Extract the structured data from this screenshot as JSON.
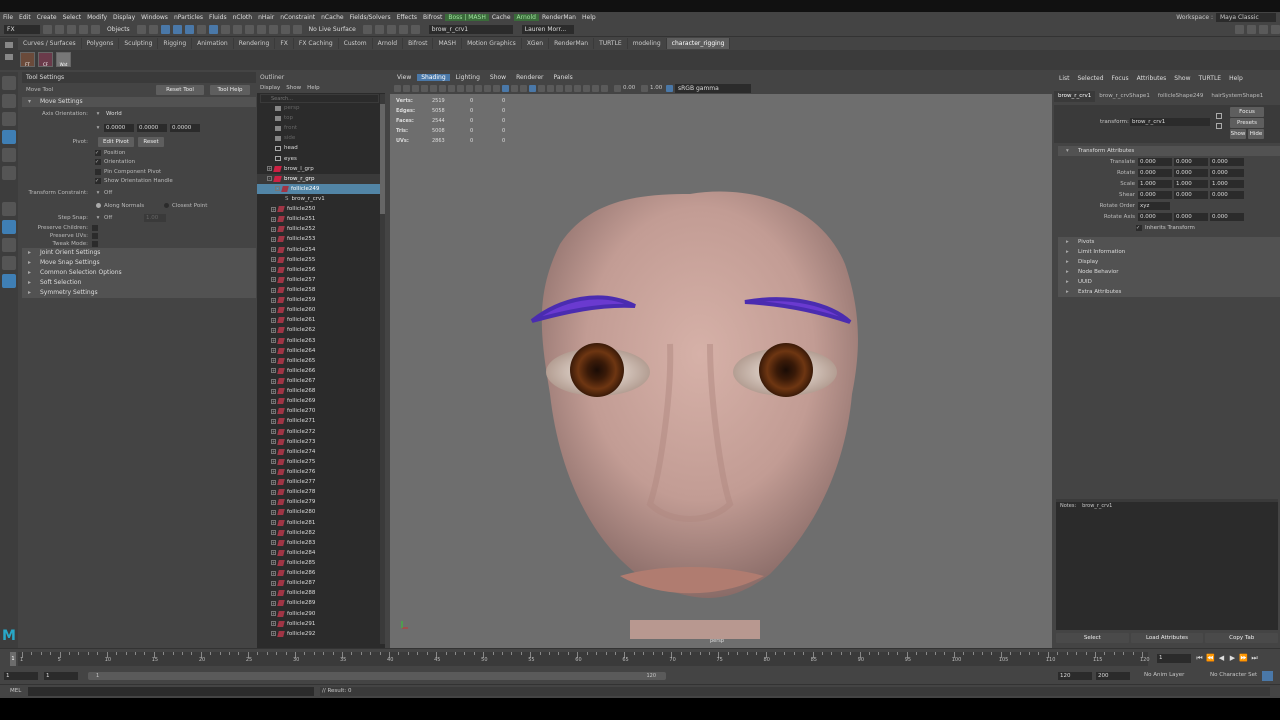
{
  "menubar": {
    "items": [
      "File",
      "Edit",
      "Create",
      "Select",
      "Modify",
      "Display",
      "Windows",
      "nParticles",
      "Fluids",
      "nCloth",
      "nHair",
      "nConstraint",
      "nCache",
      "Fields/Solvers",
      "Effects",
      "Bifrost",
      "Boss | MASH",
      "Cache",
      "Arnold",
      "RenderMan",
      "Help"
    ],
    "workspace_label": "Workspace :",
    "workspace_value": "Maya Classic"
  },
  "statusline": {
    "mode": "FX",
    "objects": "Objects",
    "live_surface": "No Live Surface",
    "object_field": "brow_r_crv1",
    "user": "Lauren Morr..."
  },
  "shelf": {
    "tabs": [
      "Curves / Surfaces",
      "Polygons",
      "Sculpting",
      "Rigging",
      "Animation",
      "Rendering",
      "FX",
      "FX Caching",
      "Custom",
      "Arnold",
      "Bifrost",
      "MASH",
      "Motion Graphics",
      "XGen",
      "RenderMan",
      "TURTLE",
      "modeling",
      "character_rigging"
    ],
    "active": "character_rigging",
    "icons": [
      "FT",
      "CF",
      "Wat"
    ]
  },
  "tool_settings": {
    "header": "Tool Settings",
    "tool_name": "Move Tool",
    "reset_btn": "Reset Tool",
    "help_btn": "Tool Help",
    "move_settings": "Move Settings",
    "axis_orientation_label": "Axis Orientation:",
    "axis_orientation_value": "World",
    "axis_values": [
      "0.0000",
      "0.0000",
      "0.0000"
    ],
    "pivot_label": "Pivot:",
    "edit_pivot": "Edit Pivot",
    "reset": "Reset",
    "checks": [
      "Position",
      "Orientation",
      "Pin Component Pivot",
      "Show Orientation Handle"
    ],
    "transform_constraint_label": "Transform Constraint:",
    "transform_constraint_value": "Off",
    "along_normals": "Along Normals",
    "closest_point": "Closest Point",
    "step_snap_label": "Step Snap:",
    "step_snap_value": "Off",
    "step_snap_num": "1.00",
    "preserve": [
      "Preserve Children:",
      "Preserve UVs:",
      "Tweak Mode:"
    ],
    "sections": [
      "Joint Orient Settings",
      "Move Snap Settings",
      "Common Selection Options",
      "Soft Selection",
      "Symmetry Settings"
    ]
  },
  "outliner": {
    "header": "Outliner",
    "menu": [
      "Display",
      "Show",
      "Help"
    ],
    "search_placeholder": "Search...",
    "rows_top": [
      "persp",
      "top",
      "front",
      "side",
      "head",
      "eyes",
      "brow_l_grp",
      "brow_r_grp",
      "follicle249",
      "brow_r_crv1"
    ],
    "follicles": [
      "follicle250",
      "follicle251",
      "follicle252",
      "follicle253",
      "follicle254",
      "follicle255",
      "follicle256",
      "follicle257",
      "follicle258",
      "follicle259",
      "follicle260",
      "follicle261",
      "follicle262",
      "follicle263",
      "follicle264",
      "follicle265",
      "follicle266",
      "follicle267",
      "follicle268",
      "follicle269",
      "follicle270",
      "follicle271",
      "follicle272",
      "follicle273",
      "follicle274",
      "follicle275",
      "follicle276",
      "follicle277",
      "follicle278",
      "follicle279",
      "follicle280",
      "follicle281",
      "follicle282",
      "follicle283",
      "follicle284",
      "follicle285",
      "follicle286",
      "follicle287",
      "follicle288",
      "follicle289",
      "follicle290",
      "follicle291",
      "follicle292"
    ]
  },
  "viewport": {
    "menu": [
      "View",
      "Shading",
      "Lighting",
      "Show",
      "Renderer",
      "Panels"
    ],
    "active_menu": "Shading",
    "exposure": "0.00",
    "gamma": "1.00",
    "colorspace": "sRGB gamma",
    "hud": [
      {
        "label": "Verts:",
        "a": "2519",
        "b": "0",
        "c": "0"
      },
      {
        "label": "Edges:",
        "a": "5058",
        "b": "0",
        "c": "0"
      },
      {
        "label": "Faces:",
        "a": "2544",
        "b": "0",
        "c": "0"
      },
      {
        "label": "Tris:",
        "a": "5008",
        "b": "0",
        "c": "0"
      },
      {
        "label": "UVs:",
        "a": "2863",
        "b": "0",
        "c": "0"
      }
    ],
    "camera_label": "persp"
  },
  "attribute_editor": {
    "menu": [
      "List",
      "Selected",
      "Focus",
      "Attributes",
      "Show",
      "TURTLE",
      "Help"
    ],
    "tabs": [
      "brow_r_crv1",
      "brow_r_crvShape1",
      "follicleShape249",
      "hairSystemShape1"
    ],
    "transform_label": "transform:",
    "transform_value": "brow_r_crv1",
    "focus": "Focus",
    "presets": "Presets",
    "show": "Show",
    "hide": "Hide",
    "section": "Transform Attributes",
    "rows": [
      {
        "label": "Translate",
        "v": [
          "0.000",
          "0.000",
          "0.000"
        ]
      },
      {
        "label": "Rotate",
        "v": [
          "0.000",
          "0.000",
          "0.000"
        ]
      },
      {
        "label": "Scale",
        "v": [
          "1.000",
          "1.000",
          "1.000"
        ]
      },
      {
        "label": "Shear",
        "v": [
          "0.000",
          "0.000",
          "0.000"
        ]
      }
    ],
    "rotate_order_label": "Rotate Order",
    "rotate_order": "xyz",
    "rotate_axis_label": "Rotate Axis",
    "rotate_axis": [
      "0.000",
      "0.000",
      "0.000"
    ],
    "inherits": "Inherits Transform",
    "sections": [
      "Pivots",
      "Limit Information",
      "Display",
      "Node Behavior",
      "UUID",
      "Extra Attributes"
    ],
    "notes_label": "Notes:",
    "notes_value": "brow_r_crv1",
    "bottom_buttons": [
      "Select",
      "Load Attributes",
      "Copy Tab"
    ]
  },
  "timeline": {
    "ticks": [
      "1",
      "5",
      "10",
      "15",
      "20",
      "25",
      "30",
      "35",
      "40",
      "45",
      "50",
      "55",
      "60",
      "65",
      "70",
      "75",
      "80",
      "85",
      "90",
      "95",
      "100",
      "105",
      "110",
      "115",
      "120"
    ],
    "current": "1"
  },
  "range": {
    "start": "1",
    "inner_start": "1",
    "inner_end": "120",
    "end1": "120",
    "end2": "200",
    "anim_layer": "No Anim Layer",
    "char_set": "No Character Set"
  },
  "cmd": {
    "lang": "MEL",
    "result": "// Result: 0"
  }
}
